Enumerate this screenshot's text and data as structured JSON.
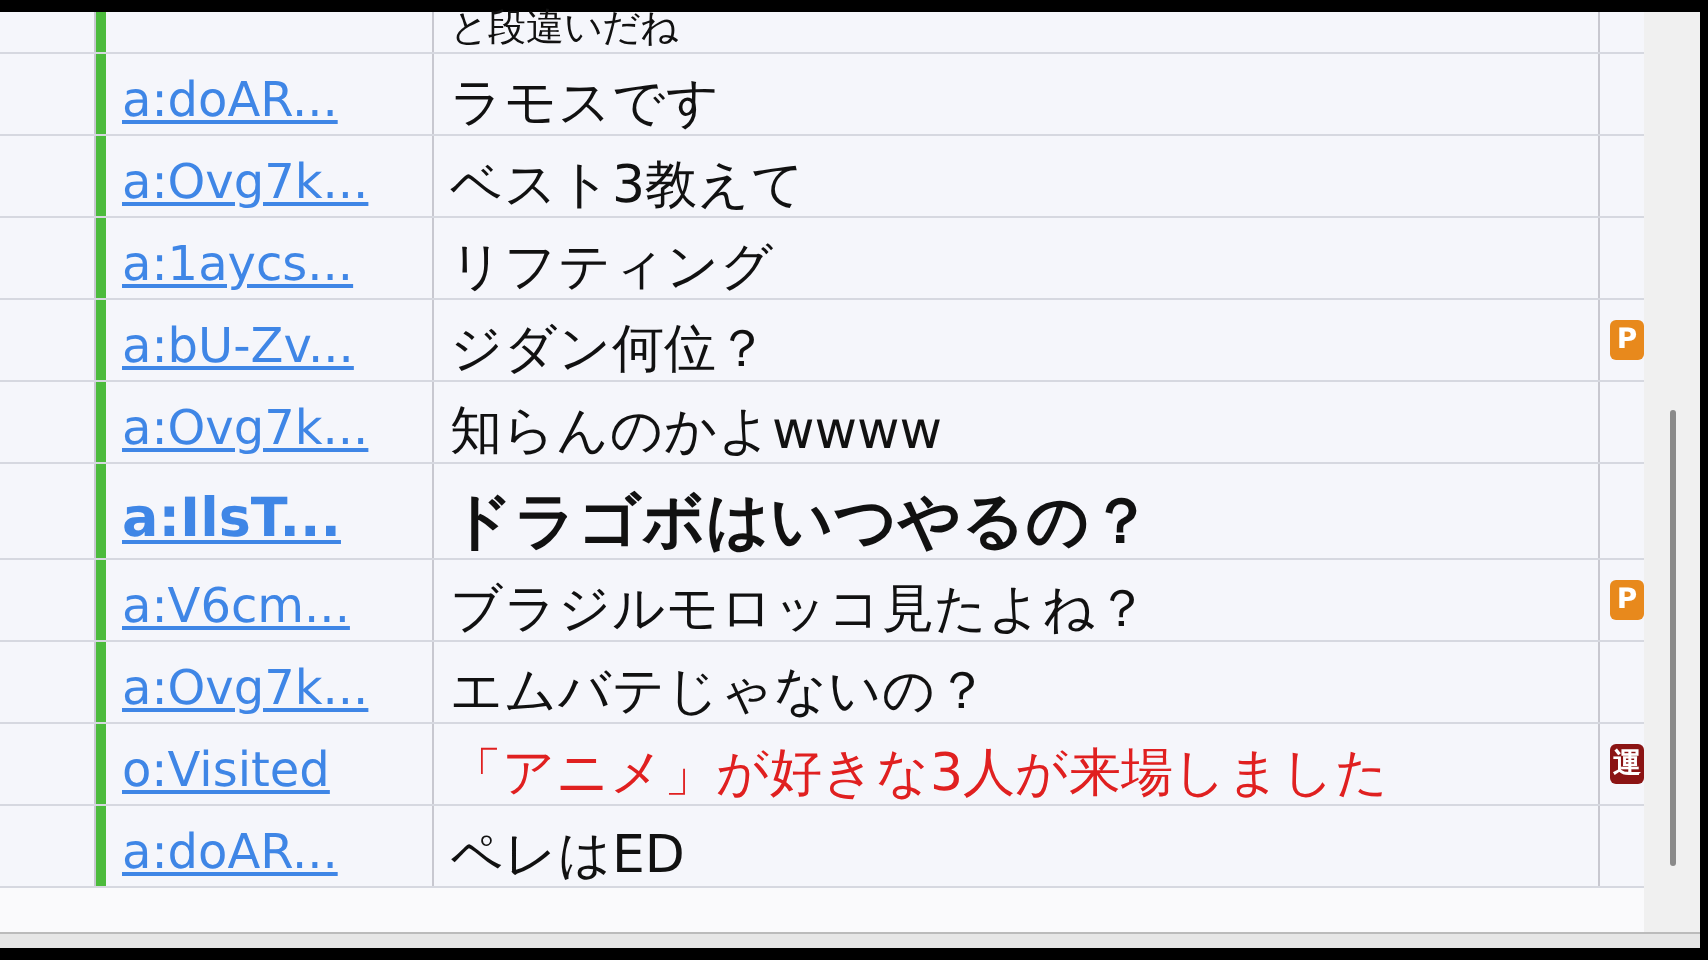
{
  "rows": [
    {
      "user": "",
      "message": "と段違いだね",
      "bold": false,
      "color": "#111111"
    },
    {
      "user": "a:doAR...",
      "message": "ラモスです",
      "bold": false,
      "color": "#111111"
    },
    {
      "user": "a:Ovg7k...",
      "message": "ベスト3教えて",
      "bold": false,
      "color": "#111111"
    },
    {
      "user": "a:1aycs...",
      "message": "リフティング",
      "bold": false,
      "color": "#111111"
    },
    {
      "user": "a:bU-Zv...",
      "message": "ジダン何位？",
      "bold": false,
      "color": "#111111",
      "badge": {
        "kind": "premium",
        "label": "P"
      }
    },
    {
      "user": "a:Ovg7k...",
      "message": "知らんのかよwwww",
      "bold": false,
      "color": "#111111"
    },
    {
      "user": "a:IlsT...",
      "message": "ドラゴボはいつやるの？",
      "bold": true,
      "color": "#111111"
    },
    {
      "user": "a:V6cm...",
      "message": "ブラジルモロッコ見たよね？",
      "bold": false,
      "color": "#111111",
      "badge": {
        "kind": "premium",
        "label": "P"
      }
    },
    {
      "user": "a:Ovg7k...",
      "message": "エムバテじゃないの？",
      "bold": false,
      "color": "#111111"
    },
    {
      "user": "o:Visited",
      "message": "「アニメ」が好きな3人が来場しました",
      "bold": false,
      "color": "#e02020",
      "badge": {
        "kind": "operator",
        "label": "運"
      }
    },
    {
      "user": "a:doAR...",
      "message": "ペレはED",
      "bold": false,
      "color": "#111111"
    }
  ]
}
